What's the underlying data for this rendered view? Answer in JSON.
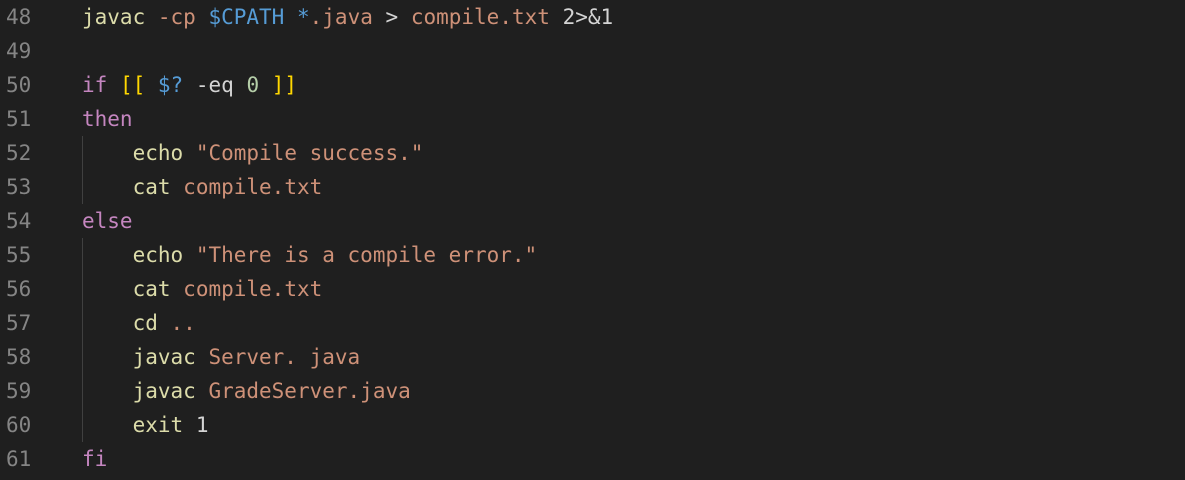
{
  "theme": {
    "background": "#1f1f1f",
    "line_number_color": "#858585",
    "indent_guide_color": "#404040",
    "token_colors": {
      "cmd": "#dcdcaa",
      "str": "#ce9178",
      "kw": "#c586c0",
      "var": "#569cd6",
      "op": "#d4d4d4",
      "num": "#b5cea8",
      "br1": "#ffd700",
      "plain": "#d4d4d4"
    }
  },
  "editor": {
    "lines": [
      {
        "number": "48",
        "tokens": [
          {
            "text": "javac",
            "type": "cmd"
          },
          {
            "text": " ",
            "type": "plain"
          },
          {
            "text": "-cp",
            "type": "str"
          },
          {
            "text": " ",
            "type": "plain"
          },
          {
            "text": "$CPATH",
            "type": "var"
          },
          {
            "text": " ",
            "type": "plain"
          },
          {
            "text": "*",
            "type": "var"
          },
          {
            "text": ".java",
            "type": "str"
          },
          {
            "text": " ",
            "type": "plain"
          },
          {
            "text": ">",
            "type": "op"
          },
          {
            "text": " ",
            "type": "plain"
          },
          {
            "text": "compile.txt",
            "type": "str"
          },
          {
            "text": " ",
            "type": "plain"
          },
          {
            "text": "2>&1",
            "type": "plain"
          }
        ]
      },
      {
        "number": "49",
        "tokens": []
      },
      {
        "number": "50",
        "tokens": [
          {
            "text": "if",
            "type": "kw"
          },
          {
            "text": " ",
            "type": "plain"
          },
          {
            "text": "[[",
            "type": "br1"
          },
          {
            "text": " ",
            "type": "plain"
          },
          {
            "text": "$?",
            "type": "var"
          },
          {
            "text": " ",
            "type": "plain"
          },
          {
            "text": "-eq",
            "type": "plain"
          },
          {
            "text": " ",
            "type": "plain"
          },
          {
            "text": "0",
            "type": "num"
          },
          {
            "text": " ",
            "type": "plain"
          },
          {
            "text": "]]",
            "type": "br1"
          }
        ]
      },
      {
        "number": "51",
        "tokens": [
          {
            "text": "then",
            "type": "kw"
          }
        ]
      },
      {
        "number": "52",
        "tokens": [
          {
            "text": "    ",
            "type": "plain"
          },
          {
            "text": "echo",
            "type": "cmd"
          },
          {
            "text": " ",
            "type": "plain"
          },
          {
            "text": "\"Compile success.\"",
            "type": "str"
          }
        ]
      },
      {
        "number": "53",
        "tokens": [
          {
            "text": "    ",
            "type": "plain"
          },
          {
            "text": "cat",
            "type": "cmd"
          },
          {
            "text": " ",
            "type": "plain"
          },
          {
            "text": "compile.txt",
            "type": "str"
          }
        ]
      },
      {
        "number": "54",
        "tokens": [
          {
            "text": "else",
            "type": "kw"
          }
        ]
      },
      {
        "number": "55",
        "tokens": [
          {
            "text": "    ",
            "type": "plain"
          },
          {
            "text": "echo",
            "type": "cmd"
          },
          {
            "text": " ",
            "type": "plain"
          },
          {
            "text": "\"There is a compile error.\"",
            "type": "str"
          }
        ]
      },
      {
        "number": "56",
        "tokens": [
          {
            "text": "    ",
            "type": "plain"
          },
          {
            "text": "cat",
            "type": "cmd"
          },
          {
            "text": " ",
            "type": "plain"
          },
          {
            "text": "compile.txt",
            "type": "str"
          }
        ]
      },
      {
        "number": "57",
        "tokens": [
          {
            "text": "    ",
            "type": "plain"
          },
          {
            "text": "cd",
            "type": "cmd"
          },
          {
            "text": " ",
            "type": "plain"
          },
          {
            "text": "..",
            "type": "str"
          }
        ]
      },
      {
        "number": "58",
        "tokens": [
          {
            "text": "    ",
            "type": "plain"
          },
          {
            "text": "javac",
            "type": "cmd"
          },
          {
            "text": " ",
            "type": "plain"
          },
          {
            "text": "Server.",
            "type": "str"
          },
          {
            "text": " ",
            "type": "plain"
          },
          {
            "text": "java",
            "type": "str"
          }
        ]
      },
      {
        "number": "59",
        "tokens": [
          {
            "text": "    ",
            "type": "plain"
          },
          {
            "text": "javac",
            "type": "cmd"
          },
          {
            "text": " ",
            "type": "plain"
          },
          {
            "text": "GradeServer.java",
            "type": "str"
          }
        ]
      },
      {
        "number": "60",
        "tokens": [
          {
            "text": "    ",
            "type": "plain"
          },
          {
            "text": "exit",
            "type": "cmd"
          },
          {
            "text": " ",
            "type": "plain"
          },
          {
            "text": "1",
            "type": "plain"
          }
        ]
      },
      {
        "number": "61",
        "tokens": [
          {
            "text": "fi",
            "type": "kw"
          }
        ]
      }
    ]
  }
}
